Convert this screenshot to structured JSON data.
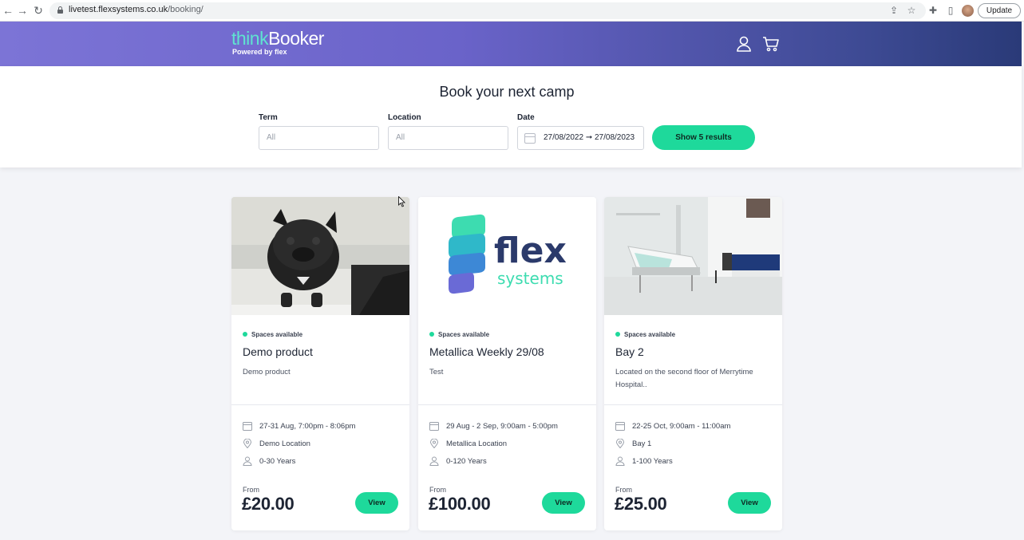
{
  "browser": {
    "url_host": "livetest.flexsystems.co.uk",
    "url_path": "/booking/",
    "update_label": "Update"
  },
  "header": {
    "logo_think": "think",
    "logo_booker": "Booker",
    "logo_tagline": "Powered by flex",
    "icons": [
      "user-icon",
      "cart-icon"
    ]
  },
  "search": {
    "title": "Book your next camp",
    "term_label": "Term",
    "term_placeholder": "All",
    "location_label": "Location",
    "location_placeholder": "All",
    "date_label": "Date",
    "date_value": "27/08/2022 ➞ 27/08/2023",
    "show_button": "Show 5 results"
  },
  "cards": [
    {
      "image": "dog-photo",
      "status": "Spaces available",
      "title": "Demo product",
      "description": "Demo product",
      "dates": "27-31 Aug, 7:00pm - 8:06pm",
      "location": "Demo Location",
      "age": "0-30 Years",
      "from_label": "From",
      "price": "£20.00",
      "button": "View"
    },
    {
      "image": "flex-systems-logo",
      "status": "Spaces available",
      "title": "Metallica Weekly 29/08",
      "description": "Test",
      "dates": "29 Aug - 2 Sep, 9:00am - 5:00pm",
      "location": "Metallica Location",
      "age": "0-120 Years",
      "from_label": "From",
      "price": "£100.00",
      "button": "View"
    },
    {
      "image": "hospital-room-photo",
      "status": "Spaces available",
      "title": "Bay 2",
      "description": "Located on the second floor of Merrytime Hospital..",
      "dates": "22-25 Oct, 9:00am - 11:00am",
      "location": "Bay 1",
      "age": "1-100 Years",
      "from_label": "From",
      "price": "£25.00",
      "button": "View"
    }
  ],
  "flex_logo": {
    "word1": "flex",
    "word2": "systems"
  },
  "colors": {
    "accent_green": "#1ed99b",
    "header_start": "#7c74d6",
    "header_end": "#2a3a78",
    "logo_teal": "#5fe3d0",
    "flex_navy": "#2b3a6b"
  }
}
